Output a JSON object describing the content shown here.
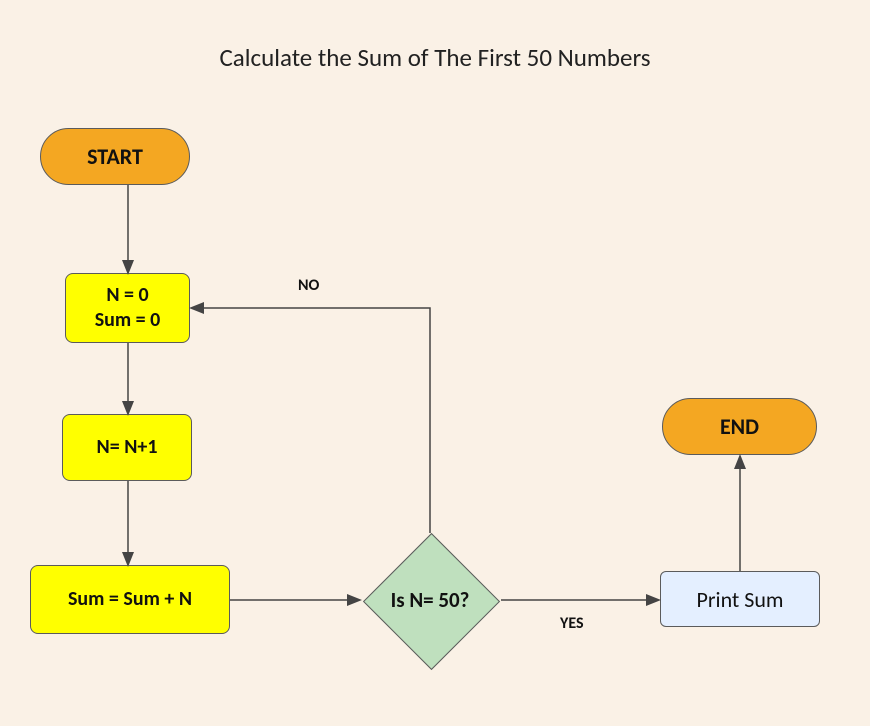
{
  "title": "Calculate the Sum of The First 50 Numbers",
  "nodes": {
    "start": "START",
    "init_line1": "N = 0",
    "init_line2": "Sum = 0",
    "increment": "N= N+1",
    "accumulate": "Sum = Sum + N",
    "decision": "Is N= 50?",
    "print": "Print Sum",
    "end": "END"
  },
  "edges": {
    "no": "NO",
    "yes": "YES"
  }
}
